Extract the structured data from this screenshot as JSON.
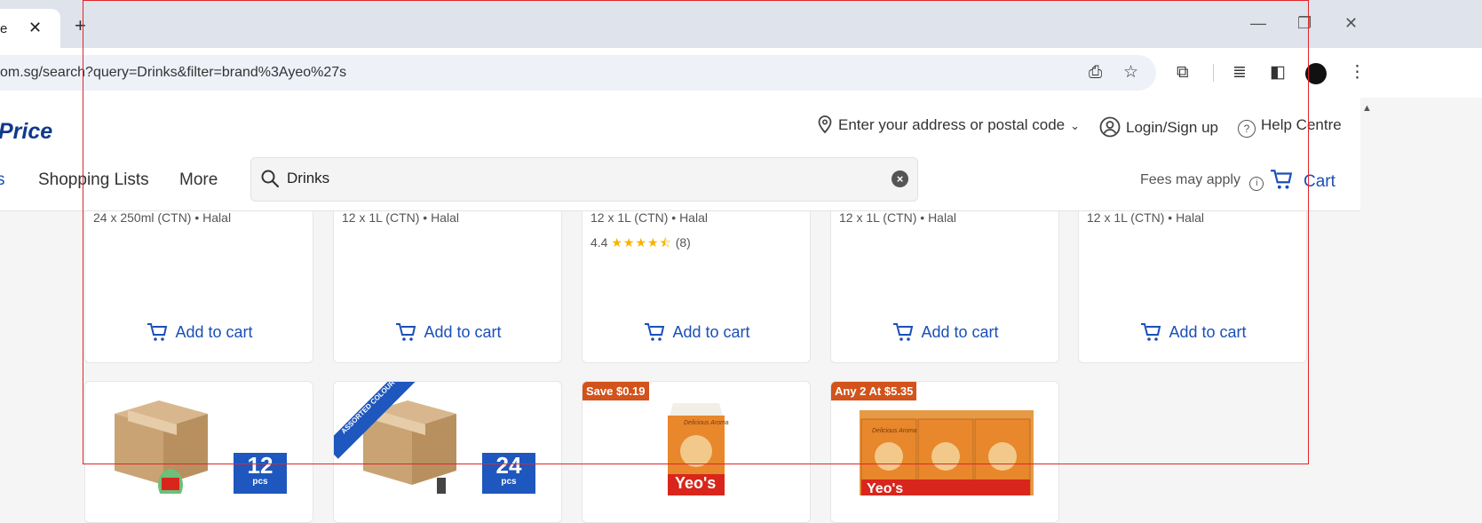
{
  "browser": {
    "tab_title_fragment": "e",
    "url": "om.sg/search?query=Drinks&filter=brand%3Ayeo%27s"
  },
  "header": {
    "logo_text": "Price",
    "address_placeholder": "Enter your address or postal code",
    "login_label": "Login/Sign up",
    "help_label": "Help Centre",
    "nav": {
      "edge_item": "s",
      "shopping_lists": "Shopping Lists",
      "more": "More"
    },
    "search": {
      "value": "Drinks"
    },
    "fees_label": "Fees may apply",
    "cart_label": "Cart"
  },
  "products_row1": [
    {
      "spec": "24 x 250ml (CTN) • Halal",
      "add_label": "Add to cart"
    },
    {
      "spec": "12 x 1L (CTN) • Halal",
      "add_label": "Add to cart"
    },
    {
      "spec": "12 x 1L (CTN) • Halal",
      "rating": "4.4",
      "review_count": "(8)",
      "stars": 4.4,
      "add_label": "Add to cart"
    },
    {
      "spec": "12 x 1L (CTN) • Halal",
      "add_label": "Add to cart"
    },
    {
      "spec": "12 x 1L (CTN) • Halal",
      "add_label": "Add to cart"
    }
  ],
  "products_row2": [
    {
      "pack_count": "12",
      "pack_unit": "pcs"
    },
    {
      "pack_count": "24",
      "pack_unit": "pcs",
      "ribbon": "ASSORTED COLOUR"
    },
    {
      "promo": "Save $0.19",
      "brand_text": "Yeo's",
      "carton_text": "Delicious Aroma"
    },
    {
      "promo": "Any 2 At $5.35",
      "brand_text": "Yeo's",
      "carton_text": "Delicious Aroma"
    }
  ],
  "colors": {
    "accent": "#1a4fb8",
    "promo": "#d2531b",
    "stars": "#f4b400",
    "highlight_frame": "#e0262b"
  }
}
